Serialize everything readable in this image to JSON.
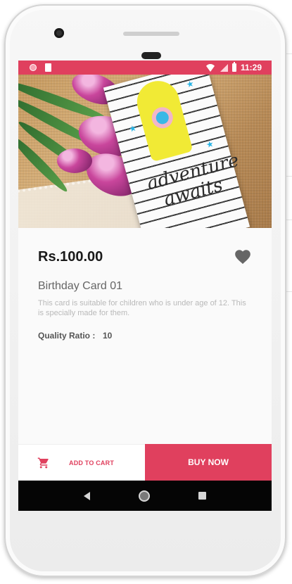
{
  "status_bar": {
    "time": "11:29"
  },
  "product": {
    "price": "Rs.100.00",
    "title": "Birthday Card 01",
    "description": "This card is suitable for children who is under age of 12. This is specially made for them.",
    "quality_ratio_label": "Quality Ratio :",
    "quality_ratio_value": "10",
    "image_text": "adventure awaits"
  },
  "actions": {
    "add_to_cart_label": "ADD TO CART",
    "buy_now_label": "BUY NOW"
  },
  "icons": [
    "heart-icon",
    "cart-icon",
    "back-icon",
    "home-icon",
    "recents-icon",
    "wifi-icon",
    "signal-icon",
    "battery-icon"
  ],
  "colors": {
    "accent": "#e0405e",
    "status_bar": "#e0405e",
    "nav_bar": "#050505",
    "heart": "#666666"
  }
}
